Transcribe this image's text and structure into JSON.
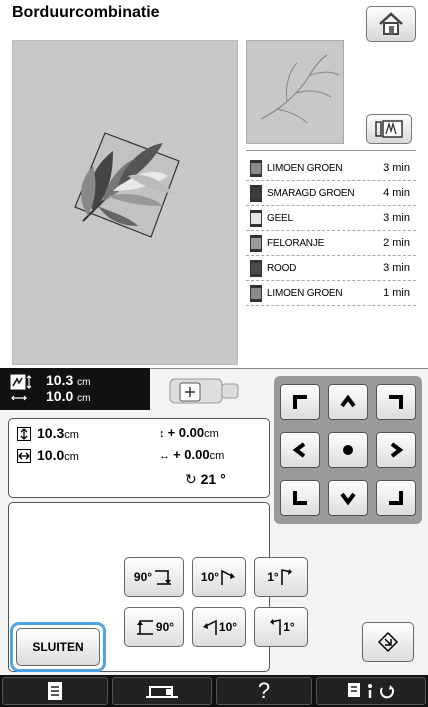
{
  "header": {
    "title": "Borduurcombinatie"
  },
  "threads": [
    {
      "name": "LIMOEN GROEN",
      "time": "3 min",
      "color": "#8a8a8a"
    },
    {
      "name": "SMARAGD GROEN",
      "time": "4 min",
      "color": "#3d3d3d"
    },
    {
      "name": "GEEL",
      "time": "3 min",
      "color": "#e6e6e6"
    },
    {
      "name": "FELORANJE",
      "time": "2 min",
      "color": "#9a9a9a"
    },
    {
      "name": "ROOD",
      "time": "3 min",
      "color": "#4a4a4a"
    },
    {
      "name": "LIMOEN GROEN",
      "time": "1 min",
      "color": "#8a8a8a"
    }
  ],
  "size_display": {
    "height": "10.3",
    "width": "10.0",
    "unit": "cm"
  },
  "info": {
    "height": "10.3",
    "width": "10.0",
    "unit": "cm",
    "offset_v": "+ 0.00",
    "offset_h": "+ 0.00",
    "offset_unit": "cm",
    "rotation": "21 °"
  },
  "rotate_buttons": {
    "r90": "90°",
    "r10": "10°",
    "r1": "1°",
    "l90": "90°",
    "l10": "10°",
    "l1": "1°"
  },
  "close_label": "SLUITEN",
  "footer": {
    "help": "?"
  },
  "icons": {
    "home": "home-icon",
    "view": "view-icon",
    "size": "size-icon",
    "frame": "frame-icon",
    "reset": "reset-icon",
    "page": "page-icon",
    "machine": "machine-icon",
    "settings": "settings-icon"
  }
}
